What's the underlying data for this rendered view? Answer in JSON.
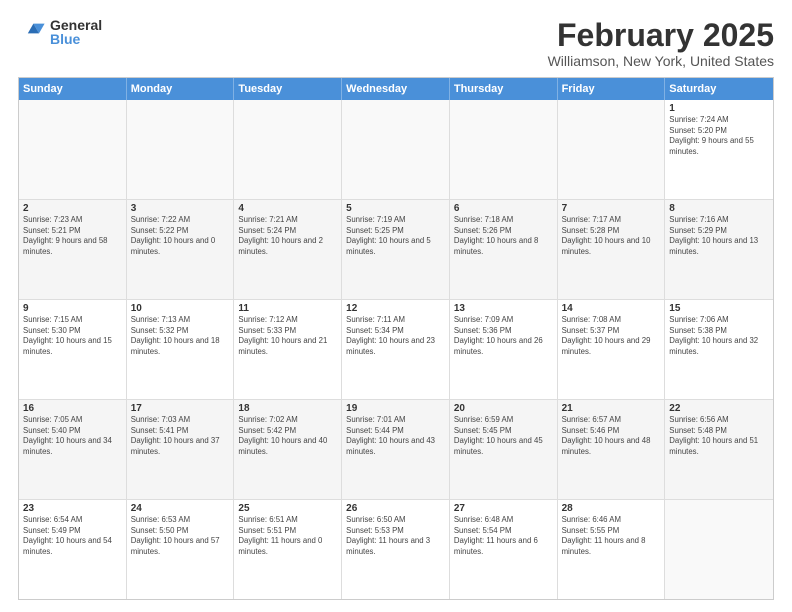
{
  "header": {
    "logo_general": "General",
    "logo_blue": "Blue",
    "title": "February 2025",
    "subtitle": "Williamson, New York, United States"
  },
  "days_of_week": [
    "Sunday",
    "Monday",
    "Tuesday",
    "Wednesday",
    "Thursday",
    "Friday",
    "Saturday"
  ],
  "weeks": [
    [
      {
        "day": "",
        "info": ""
      },
      {
        "day": "",
        "info": ""
      },
      {
        "day": "",
        "info": ""
      },
      {
        "day": "",
        "info": ""
      },
      {
        "day": "",
        "info": ""
      },
      {
        "day": "",
        "info": ""
      },
      {
        "day": "1",
        "info": "Sunrise: 7:24 AM\nSunset: 5:20 PM\nDaylight: 9 hours and 55 minutes."
      }
    ],
    [
      {
        "day": "2",
        "info": "Sunrise: 7:23 AM\nSunset: 5:21 PM\nDaylight: 9 hours and 58 minutes."
      },
      {
        "day": "3",
        "info": "Sunrise: 7:22 AM\nSunset: 5:22 PM\nDaylight: 10 hours and 0 minutes."
      },
      {
        "day": "4",
        "info": "Sunrise: 7:21 AM\nSunset: 5:24 PM\nDaylight: 10 hours and 2 minutes."
      },
      {
        "day": "5",
        "info": "Sunrise: 7:19 AM\nSunset: 5:25 PM\nDaylight: 10 hours and 5 minutes."
      },
      {
        "day": "6",
        "info": "Sunrise: 7:18 AM\nSunset: 5:26 PM\nDaylight: 10 hours and 8 minutes."
      },
      {
        "day": "7",
        "info": "Sunrise: 7:17 AM\nSunset: 5:28 PM\nDaylight: 10 hours and 10 minutes."
      },
      {
        "day": "8",
        "info": "Sunrise: 7:16 AM\nSunset: 5:29 PM\nDaylight: 10 hours and 13 minutes."
      }
    ],
    [
      {
        "day": "9",
        "info": "Sunrise: 7:15 AM\nSunset: 5:30 PM\nDaylight: 10 hours and 15 minutes."
      },
      {
        "day": "10",
        "info": "Sunrise: 7:13 AM\nSunset: 5:32 PM\nDaylight: 10 hours and 18 minutes."
      },
      {
        "day": "11",
        "info": "Sunrise: 7:12 AM\nSunset: 5:33 PM\nDaylight: 10 hours and 21 minutes."
      },
      {
        "day": "12",
        "info": "Sunrise: 7:11 AM\nSunset: 5:34 PM\nDaylight: 10 hours and 23 minutes."
      },
      {
        "day": "13",
        "info": "Sunrise: 7:09 AM\nSunset: 5:36 PM\nDaylight: 10 hours and 26 minutes."
      },
      {
        "day": "14",
        "info": "Sunrise: 7:08 AM\nSunset: 5:37 PM\nDaylight: 10 hours and 29 minutes."
      },
      {
        "day": "15",
        "info": "Sunrise: 7:06 AM\nSunset: 5:38 PM\nDaylight: 10 hours and 32 minutes."
      }
    ],
    [
      {
        "day": "16",
        "info": "Sunrise: 7:05 AM\nSunset: 5:40 PM\nDaylight: 10 hours and 34 minutes."
      },
      {
        "day": "17",
        "info": "Sunrise: 7:03 AM\nSunset: 5:41 PM\nDaylight: 10 hours and 37 minutes."
      },
      {
        "day": "18",
        "info": "Sunrise: 7:02 AM\nSunset: 5:42 PM\nDaylight: 10 hours and 40 minutes."
      },
      {
        "day": "19",
        "info": "Sunrise: 7:01 AM\nSunset: 5:44 PM\nDaylight: 10 hours and 43 minutes."
      },
      {
        "day": "20",
        "info": "Sunrise: 6:59 AM\nSunset: 5:45 PM\nDaylight: 10 hours and 45 minutes."
      },
      {
        "day": "21",
        "info": "Sunrise: 6:57 AM\nSunset: 5:46 PM\nDaylight: 10 hours and 48 minutes."
      },
      {
        "day": "22",
        "info": "Sunrise: 6:56 AM\nSunset: 5:48 PM\nDaylight: 10 hours and 51 minutes."
      }
    ],
    [
      {
        "day": "23",
        "info": "Sunrise: 6:54 AM\nSunset: 5:49 PM\nDaylight: 10 hours and 54 minutes."
      },
      {
        "day": "24",
        "info": "Sunrise: 6:53 AM\nSunset: 5:50 PM\nDaylight: 10 hours and 57 minutes."
      },
      {
        "day": "25",
        "info": "Sunrise: 6:51 AM\nSunset: 5:51 PM\nDaylight: 11 hours and 0 minutes."
      },
      {
        "day": "26",
        "info": "Sunrise: 6:50 AM\nSunset: 5:53 PM\nDaylight: 11 hours and 3 minutes."
      },
      {
        "day": "27",
        "info": "Sunrise: 6:48 AM\nSunset: 5:54 PM\nDaylight: 11 hours and 6 minutes."
      },
      {
        "day": "28",
        "info": "Sunrise: 6:46 AM\nSunset: 5:55 PM\nDaylight: 11 hours and 8 minutes."
      },
      {
        "day": "",
        "info": ""
      }
    ]
  ]
}
